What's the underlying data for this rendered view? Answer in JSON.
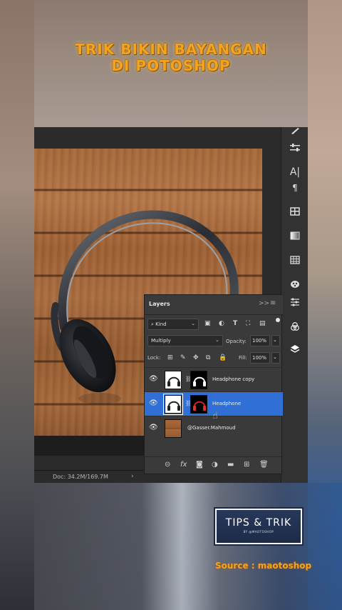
{
  "overlay": {
    "title_line1": "TRIK BIKIN BAYANGAN",
    "title_line2": "DI POTOSHOP",
    "badge_main": "TIPS & TRIK",
    "badge_sub": "BY @MAOTOSHOP",
    "source": "Source : maotoshop"
  },
  "status": {
    "doc": "Doc: 34.2M/169.7M",
    "arrow": "›"
  },
  "right_toolbar": [
    "brush-icon",
    "adjust-sliders-icon",
    "character-icon",
    "paragraph-icon",
    "libraries-icon",
    "gradient-icon",
    "swatches-grid-icon",
    "color-wheel-icon",
    "adjustments-icon",
    "channels-icon",
    "layers-icon"
  ],
  "layers_panel": {
    "tab": "Layers",
    "collapse": ">>",
    "menu": "≡",
    "filter": {
      "label": "Kind"
    },
    "blend_mode": "Multiply",
    "opacity_label": "Opacity:",
    "opacity_value": "100%",
    "lock_label": "Lock:",
    "fill_label": "Fill:",
    "fill_value": "100%",
    "layers": [
      {
        "name": "Headphone copy",
        "selected": false
      },
      {
        "name": "Headphone",
        "selected": true
      },
      {
        "name": "@Gasser.Mahmoud",
        "selected": false
      }
    ]
  },
  "colors": {
    "title": "#f7a21b",
    "selected_layer": "#2f6fd6",
    "panel_bg": "#3a3a3a"
  }
}
